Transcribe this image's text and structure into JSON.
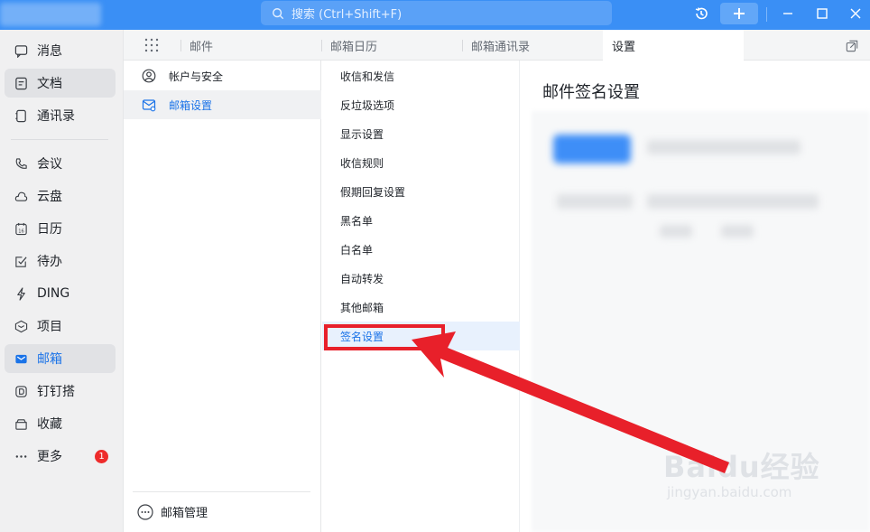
{
  "titlebar": {
    "search_placeholder": "搜索 (Ctrl+Shift+F)"
  },
  "leftnav": {
    "items": [
      {
        "label": "消息",
        "icon": "message-icon"
      },
      {
        "label": "文档",
        "icon": "document-icon"
      },
      {
        "label": "通讯录",
        "icon": "contacts-icon"
      },
      {
        "label": "会议",
        "icon": "phone-icon"
      },
      {
        "label": "云盘",
        "icon": "cloud-icon"
      },
      {
        "label": "日历",
        "icon": "calendar-icon"
      },
      {
        "label": "待办",
        "icon": "todo-icon"
      },
      {
        "label": "DING",
        "icon": "lightning-icon"
      },
      {
        "label": "项目",
        "icon": "project-icon"
      },
      {
        "label": "邮箱",
        "icon": "mail-icon"
      },
      {
        "label": "钉钉搭",
        "icon": "builder-icon"
      },
      {
        "label": "收藏",
        "icon": "favorites-icon"
      },
      {
        "label": "更多",
        "icon": "more-icon",
        "badge": "1"
      }
    ]
  },
  "tabs": [
    {
      "label": "邮件"
    },
    {
      "label": "邮箱日历"
    },
    {
      "label": "邮箱通讯录"
    },
    {
      "label": "设置"
    }
  ],
  "categories": {
    "items": [
      {
        "label": "帐户与安全"
      },
      {
        "label": "邮箱设置"
      }
    ],
    "footer_label": "邮箱管理"
  },
  "sub_settings": {
    "items": [
      {
        "label": "收信和发信"
      },
      {
        "label": "反垃圾选项"
      },
      {
        "label": "显示设置"
      },
      {
        "label": "收信规则"
      },
      {
        "label": "假期回复设置"
      },
      {
        "label": "黑名单"
      },
      {
        "label": "白名单"
      },
      {
        "label": "自动转发"
      },
      {
        "label": "其他邮箱"
      },
      {
        "label": "签名设置"
      }
    ]
  },
  "content": {
    "title": "邮件签名设置"
  },
  "watermark": {
    "main": "Baidu经验",
    "sub": "jingyan.baidu.com"
  },
  "colors": {
    "accent": "#1a73e8",
    "titlebar": "#3a8ff5",
    "annotation_red": "#e8202a"
  }
}
